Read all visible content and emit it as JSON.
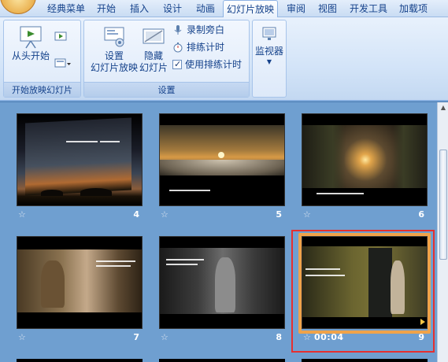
{
  "tabs": [
    "经典菜单",
    "开始",
    "插入",
    "设计",
    "动画",
    "幻灯片放映",
    "审阅",
    "视图",
    "开发工具",
    "加载项"
  ],
  "active_tab": "幻灯片放映",
  "ribbon": {
    "group_start": {
      "label": "开始放映幻灯片",
      "from_start": "从头开始"
    },
    "group_setup": {
      "label": "设置",
      "setup_show_line1": "设置",
      "setup_show_line2": "幻灯片放映",
      "hide_line1": "隐藏",
      "hide_line2": "幻灯片",
      "record_narration": "录制旁白",
      "rehearse_timings": "排练计时",
      "use_rehearsed_timings": "使用排练计时"
    },
    "group_monitor": {
      "monitor": "监视器"
    }
  },
  "slides": [
    {
      "num": "4",
      "time": ""
    },
    {
      "num": "5",
      "time": ""
    },
    {
      "num": "6",
      "time": ""
    },
    {
      "num": "7",
      "time": ""
    },
    {
      "num": "8",
      "time": ""
    },
    {
      "num": "9",
      "time": "00:04"
    }
  ],
  "colors": {
    "selection": "#e53030",
    "selection_glow": "#f0a34a",
    "sorter_bg": "#6f9fd0"
  }
}
